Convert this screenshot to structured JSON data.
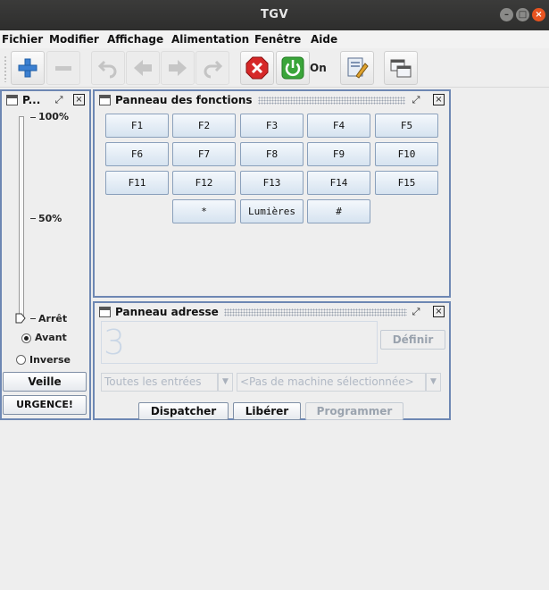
{
  "window": {
    "title": "TGV"
  },
  "menu": [
    "Fichier",
    "Modifier",
    "Affichage",
    "Alimentation",
    "Fenêtre",
    "Aide"
  ],
  "toolbar": {
    "power_label": "On",
    "icons": [
      "add-icon",
      "remove-icon",
      "undo-icon",
      "arrow-left-icon",
      "arrow-right-icon",
      "redo-icon",
      "stop-icon",
      "power-icon",
      "edit-document-icon",
      "windows-icon"
    ]
  },
  "speed_panel": {
    "title": "P...",
    "labels": {
      "top": "100%",
      "mid": "50%",
      "bottom": "Arrêt"
    },
    "value_percent": 0,
    "direction": {
      "forward": "Avant",
      "reverse": "Inverse",
      "selected": "Avant"
    },
    "standby_label": "Veille",
    "emergency_label": "URGENCE!"
  },
  "functions_panel": {
    "title": "Panneau des fonctions",
    "rows": [
      [
        "F1",
        "F2",
        "F3",
        "F4",
        "F5"
      ],
      [
        "F6",
        "F7",
        "F8",
        "F9",
        "F10"
      ],
      [
        "F11",
        "F12",
        "F13",
        "F14",
        "F15"
      ],
      [
        "*",
        "Lumières",
        "#"
      ]
    ]
  },
  "address_panel": {
    "title": "Panneau adresse",
    "address_value": "3",
    "define_label": "Définir",
    "filter_value": "Toutes les entrées",
    "machine_value": "<Pas de machine sélectionnée>",
    "dispatch_label": "Dispatcher",
    "release_label": "Libérer",
    "program_label": "Programmer"
  },
  "colors": {
    "accent": "#6d87b3",
    "close": "#e95420",
    "stop_red": "#d62828",
    "power_green": "#3aa53a"
  }
}
